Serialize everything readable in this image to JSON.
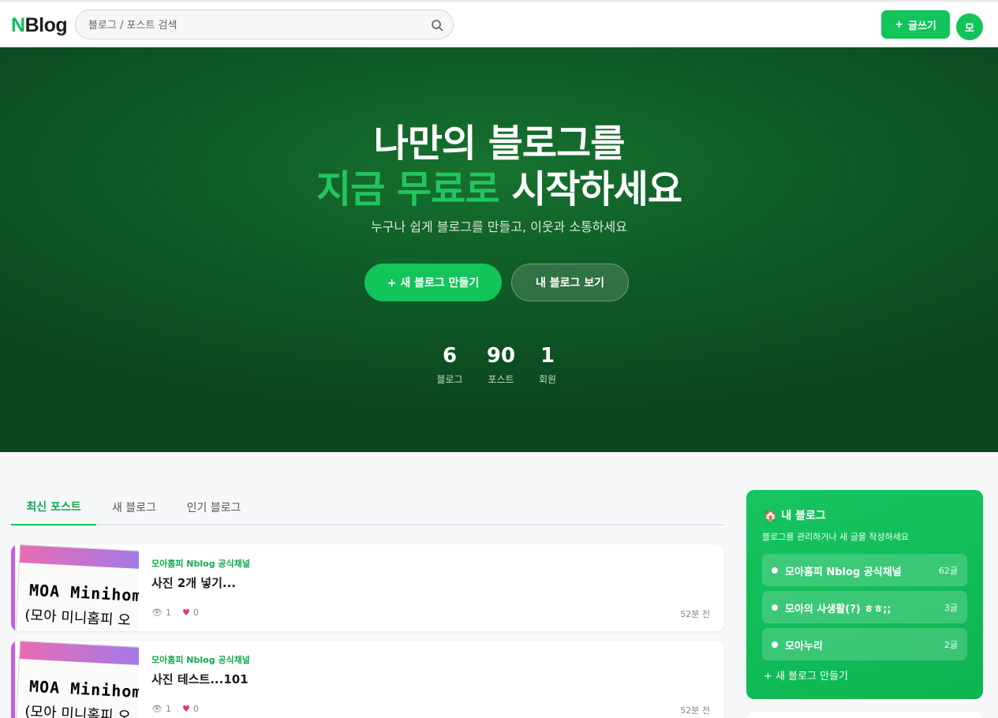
{
  "header": {
    "logo_n": "N",
    "logo_rest": "Blog",
    "search_placeholder": "블로그 / 포스트 검색",
    "write_label": "글쓰기",
    "avatar_initial": "모"
  },
  "hero": {
    "title_line1": "나만의 블로그를",
    "title_line2_accent": "지금 무료로",
    "title_line2_rest": "시작하세요",
    "subtitle": "누구나 쉽게 블로그를 만들고, 이웃과 소통하세요",
    "primary_button": "+ 새 블로그 만들기",
    "secondary_button": "내 블로그 보기",
    "stats": [
      {
        "value": "6",
        "label": "블로그"
      },
      {
        "value": "90",
        "label": "포스트"
      },
      {
        "value": "1",
        "label": "회원"
      }
    ]
  },
  "tabs": [
    "최신 포스트",
    "새 블로그",
    "인기 블로그"
  ],
  "posts": [
    {
      "blog": "모아홈피 Nblog 공식채널",
      "title": "사진 2개 넣기...",
      "views": "1",
      "likes": "0",
      "time": "52분 전",
      "thumb_text1": "MOA Minihomp",
      "thumb_text2": "(모아 미니홈피 오"
    },
    {
      "blog": "모아홈피 Nblog 공식채널",
      "title": "사진 테스트...101",
      "views": "1",
      "likes": "0",
      "time": "52분 전",
      "thumb_text1": "MOA Minihomp",
      "thumb_text2": "(모아 미니홈피 오"
    }
  ],
  "sidebar": {
    "title_icon": "🏠",
    "title": "내 블로그",
    "subtitle": "블로그를 관리하거나 새 글을 작성하세요",
    "blogs": [
      {
        "name": "모아홈피 Nblog 공식채널",
        "count": "62글"
      },
      {
        "name": "모아의 사생활(?) ㅎㅎ;;",
        "count": "3글"
      },
      {
        "name": "모아누리",
        "count": "2글"
      }
    ],
    "new_blog": "+ 새 블로그 만들기"
  },
  "colors": {
    "brand": "#12c45a",
    "hero_bg": "#0f5c27",
    "accent_text": "#22c55e"
  }
}
